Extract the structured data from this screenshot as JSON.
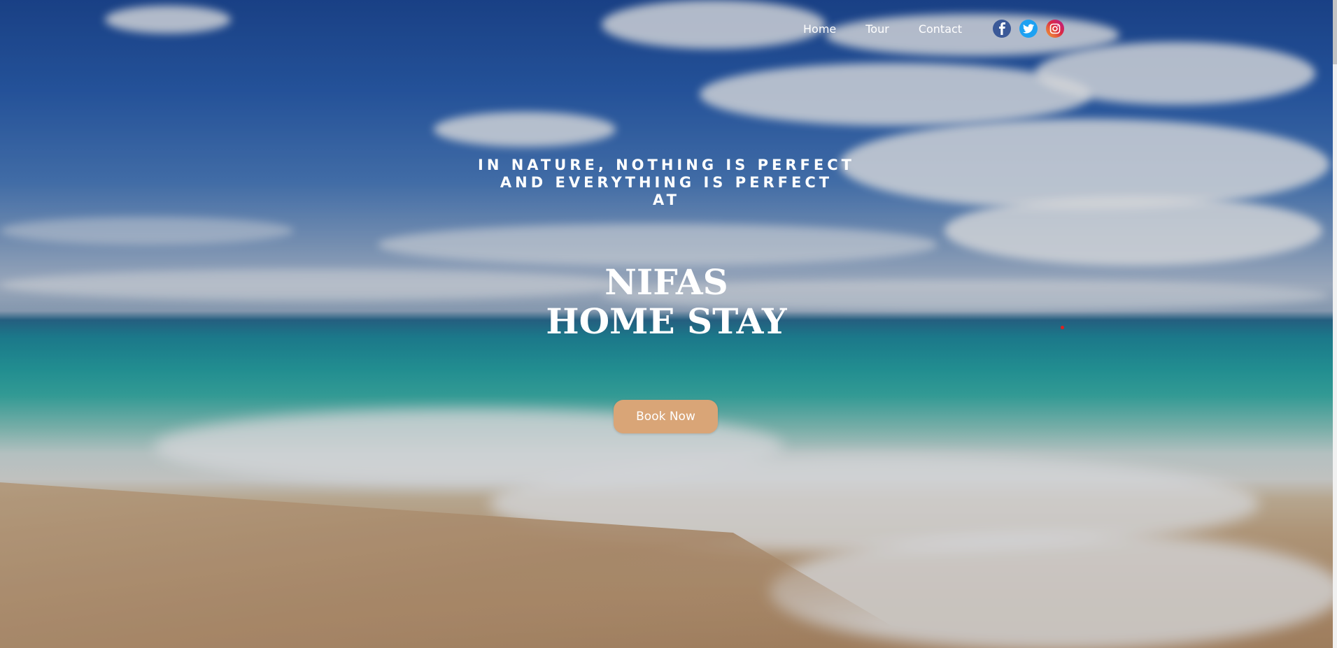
{
  "nav": {
    "items": [
      {
        "label": "Home"
      },
      {
        "label": "Tour"
      },
      {
        "label": "Contact"
      }
    ],
    "socials": [
      {
        "icon": "facebook-icon",
        "color": "#3b5998"
      },
      {
        "icon": "twitter-icon",
        "color": "#1da1f2"
      },
      {
        "icon": "instagram-icon",
        "color": "#cc2366"
      }
    ]
  },
  "hero": {
    "tagline_lines": [
      "IN NATURE, NOTHING IS PERFECT",
      "AND EVERYTHING IS PERFECT",
      "AT"
    ],
    "title_lines": [
      "NIFAS",
      "HOME STAY"
    ],
    "cta_label": "Book Now",
    "cta_color": "#d9a577"
  }
}
